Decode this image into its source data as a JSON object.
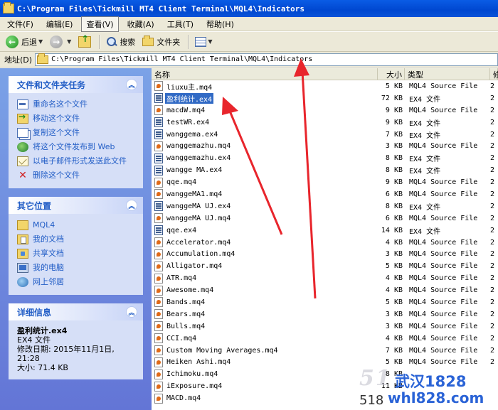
{
  "window": {
    "title": "C:\\Program Files\\Tickmill MT4 Client Terminal\\MQL4\\Indicators"
  },
  "menu": [
    "文件(F)",
    "编辑(E)",
    "查看(V)",
    "收藏(A)",
    "工具(T)",
    "帮助(H)"
  ],
  "toolbar": {
    "back": "后退",
    "search": "搜索",
    "folders": "文件夹"
  },
  "address": {
    "label": "地址(D)",
    "path": "C:\\Program Files\\Tickmill MT4 Client Terminal\\MQL4\\Indicators"
  },
  "tasks_panel": {
    "title": "文件和文件夹任务",
    "items": [
      "重命名这个文件",
      "移动这个文件",
      "复制这个文件",
      "将这个文件发布到 Web",
      "以电子邮件形式发送此文件",
      "删除这个文件"
    ]
  },
  "places_panel": {
    "title": "其它位置",
    "items": [
      "MQL4",
      "我的文档",
      "共享文档",
      "我的电脑",
      "网上邻居"
    ]
  },
  "details_panel": {
    "title": "详细信息",
    "name": "盈利统计.ex4",
    "type": "EX4 文件",
    "modified_label": "修改日期: 2015年11月1日,",
    "modified_time": "21:28",
    "size": "大小: 71.4 KB"
  },
  "columns": {
    "name": "名称",
    "size": "大小",
    "type": "类型",
    "date": "修"
  },
  "files": [
    {
      "name": "liuxu主.mq4",
      "size": "5 KB",
      "type": "MQL4 Source File",
      "date": "2",
      "kind": "mq4"
    },
    {
      "name": "盈利统计.ex4",
      "size": "72 KB",
      "type": "EX4 文件",
      "date": "2",
      "kind": "ex4",
      "selected": true
    },
    {
      "name": "macdW.mq4",
      "size": "9 KB",
      "type": "MQL4 Source File",
      "date": "2",
      "kind": "mq4"
    },
    {
      "name": "testWR.ex4",
      "size": "9 KB",
      "type": "EX4 文件",
      "date": "2",
      "kind": "ex4"
    },
    {
      "name": "wanggema.ex4",
      "size": "7 KB",
      "type": "EX4 文件",
      "date": "2",
      "kind": "ex4"
    },
    {
      "name": "wanggemazhu.mq4",
      "size": "3 KB",
      "type": "MQL4 Source File",
      "date": "2",
      "kind": "mq4"
    },
    {
      "name": "wanggemazhu.ex4",
      "size": "8 KB",
      "type": "EX4 文件",
      "date": "2",
      "kind": "ex4"
    },
    {
      "name": "wangge MA.ex4",
      "size": "8 KB",
      "type": "EX4 文件",
      "date": "2",
      "kind": "ex4"
    },
    {
      "name": "qqe.mq4",
      "size": "9 KB",
      "type": "MQL4 Source File",
      "date": "2",
      "kind": "mq4"
    },
    {
      "name": "wanggeMA1.mq4",
      "size": "6 KB",
      "type": "MQL4 Source File",
      "date": "2",
      "kind": "mq4"
    },
    {
      "name": "wanggeMA UJ.ex4",
      "size": "8 KB",
      "type": "EX4 文件",
      "date": "2",
      "kind": "ex4"
    },
    {
      "name": "wanggeMA UJ.mq4",
      "size": "6 KB",
      "type": "MQL4 Source File",
      "date": "2",
      "kind": "mq4"
    },
    {
      "name": "qqe.ex4",
      "size": "14 KB",
      "type": "EX4 文件",
      "date": "2",
      "kind": "ex4"
    },
    {
      "name": "Accelerator.mq4",
      "size": "4 KB",
      "type": "MQL4 Source File",
      "date": "2",
      "kind": "mq4"
    },
    {
      "name": "Accumulation.mq4",
      "size": "3 KB",
      "type": "MQL4 Source File",
      "date": "2",
      "kind": "mq4"
    },
    {
      "name": "Alligator.mq4",
      "size": "5 KB",
      "type": "MQL4 Source File",
      "date": "2",
      "kind": "mq4"
    },
    {
      "name": "ATR.mq4",
      "size": "4 KB",
      "type": "MQL4 Source File",
      "date": "2",
      "kind": "mq4"
    },
    {
      "name": "Awesome.mq4",
      "size": "4 KB",
      "type": "MQL4 Source File",
      "date": "2",
      "kind": "mq4"
    },
    {
      "name": "Bands.mq4",
      "size": "5 KB",
      "type": "MQL4 Source File",
      "date": "2",
      "kind": "mq4"
    },
    {
      "name": "Bears.mq4",
      "size": "3 KB",
      "type": "MQL4 Source File",
      "date": "2",
      "kind": "mq4"
    },
    {
      "name": "Bulls.mq4",
      "size": "3 KB",
      "type": "MQL4 Source File",
      "date": "2",
      "kind": "mq4"
    },
    {
      "name": "CCI.mq4",
      "size": "4 KB",
      "type": "MQL4 Source File",
      "date": "2",
      "kind": "mq4"
    },
    {
      "name": "Custom Moving Averages.mq4",
      "size": "7 KB",
      "type": "MQL4 Source File",
      "date": "2",
      "kind": "mq4"
    },
    {
      "name": "Heiken Ashi.mq4",
      "size": "5 KB",
      "type": "MQL4 Source File",
      "date": "2",
      "kind": "mq4"
    },
    {
      "name": "Ichimoku.mq4",
      "size": "8 KB",
      "type": "",
      "date": "",
      "kind": "mq4"
    },
    {
      "name": "iExposure.mq4",
      "size": "11 KB",
      "type": "",
      "date": "",
      "kind": "mq4"
    },
    {
      "name": "MACD.mq4",
      "size": "",
      "type": "",
      "date": "",
      "kind": "mq4"
    }
  ],
  "watermark": {
    "big": "51",
    "cn": "武汉1828",
    "url": "whl828.com",
    "num": "518"
  },
  "colors": {
    "title_bar": "#0047d0",
    "task_pane": "#6d8ce0",
    "selection": "#316ac5",
    "arrow": "#e8252c"
  }
}
